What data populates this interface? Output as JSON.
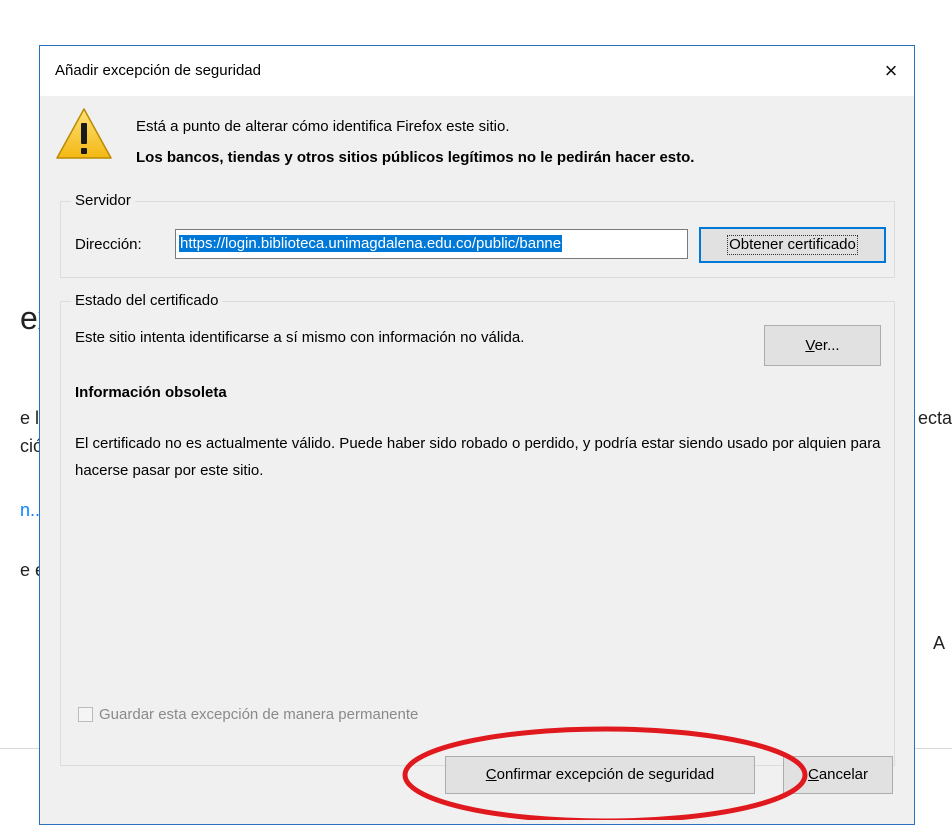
{
  "background": {
    "frag_ex": "ex",
    "frag_el": "e l",
    "frag_cion": "ción",
    "frag_link": "n...",
    "frag_ee": "e e",
    "frag_ecta": "ecta",
    "frag_a": "A"
  },
  "dialog": {
    "title": "Añadir excepción de seguridad",
    "close": "×",
    "warning_line1": "Está a punto de alterar cómo identifica Firefox este sitio.",
    "warning_line2": "Los bancos, tiendas y otros sitios públicos legítimos no le pedirán hacer esto.",
    "server": {
      "legend": "Servidor",
      "address_label": "Dirección:",
      "address_value": "https://login.biblioteca.unimagdalena.edu.co/public/banne",
      "obtain_button": "Obtener certificado"
    },
    "certificate": {
      "legend": "Estado del certificado",
      "status_text": "Este sitio intenta identificarse a sí mismo con información no válida.",
      "view_button_prefix": "V",
      "view_button_rest": "er...",
      "heading": "Información obsoleta",
      "detail": "El certificado no es actualmente válido. Puede haber sido robado o perdido, y podría estar siendo usado por alquien para hacerse pasar por este sitio."
    },
    "permanent_checkbox": "Guardar esta excepción de manera permanente",
    "confirm_button_prefix": "C",
    "confirm_button_rest": "onfirmar excepción de seguridad",
    "cancel_button_prefix": "C",
    "cancel_button_rest": "ancelar"
  },
  "colors": {
    "dialog_border": "#2b6fbf",
    "selection": "#0078d7",
    "annotation_ellipse": "#e0191e"
  },
  "icons": {
    "warning": "warning-triangle-icon",
    "close": "close-icon"
  }
}
